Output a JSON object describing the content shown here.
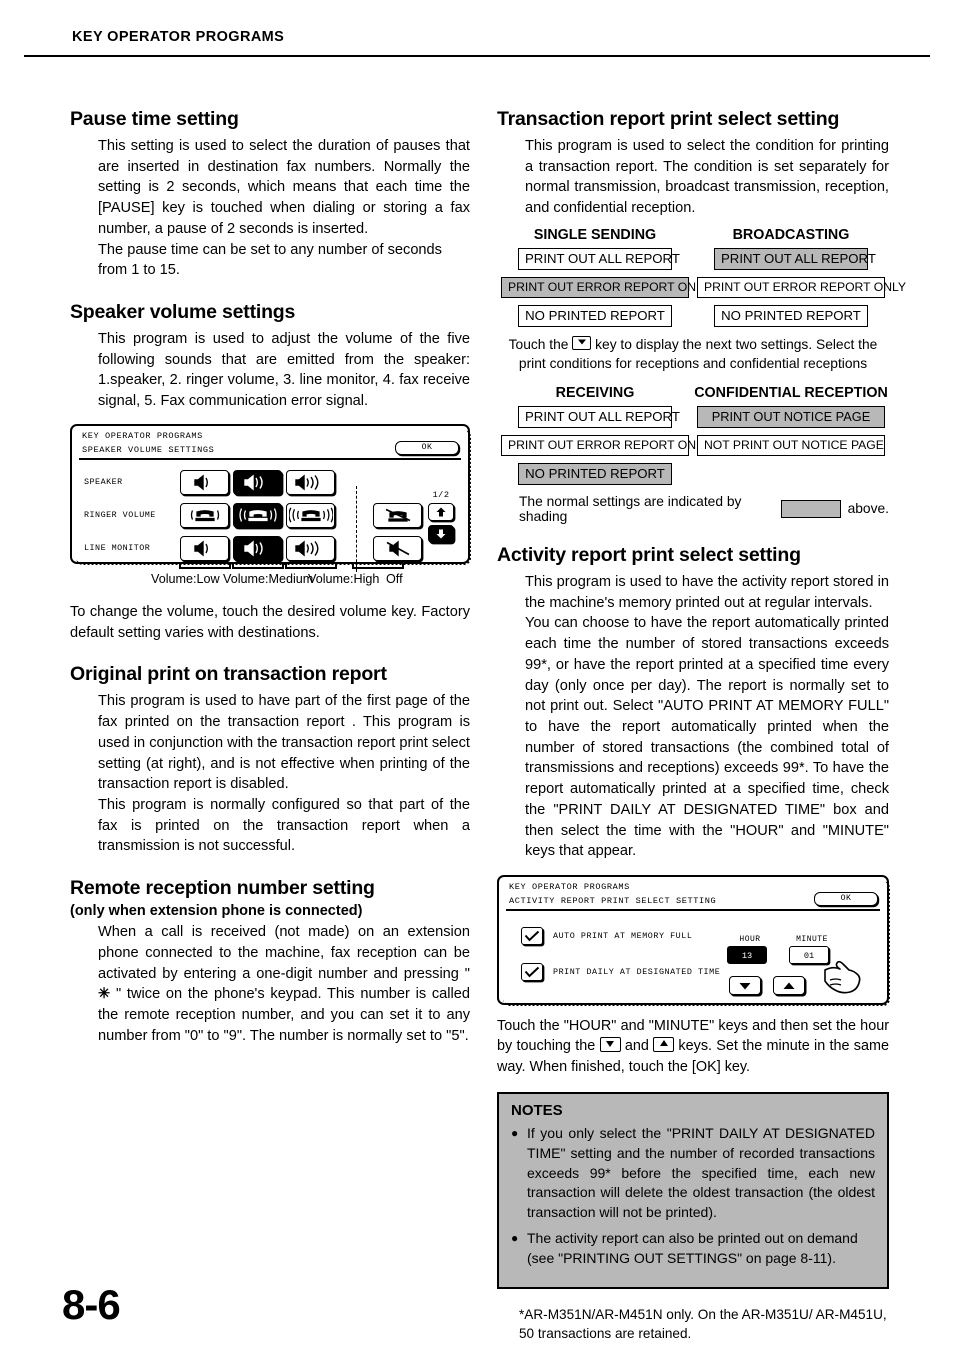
{
  "header": {
    "running_head": "KEY OPERATOR PROGRAMS"
  },
  "page_number": "8-6",
  "left_column": {
    "pause_time": {
      "heading": "Pause time setting",
      "p1": "This setting is used to select the duration of pauses that are inserted in destination fax numbers. Normally the setting is 2 seconds, which means that each time the [PAUSE] key is touched when dialing or storing a fax number, a pause of 2 seconds is inserted.",
      "p2": "The pause time can be set to any number of seconds from 1 to 15."
    },
    "speaker_volume": {
      "heading": "Speaker volume settings",
      "p1": "This program is used to adjust the volume of the five following sounds that are emitted from the speaker: 1.speaker, 2. ringer volume, 3. line monitor, 4. fax receive signal, 5. Fax communication error signal.",
      "panel": {
        "title_line1": "KEY OPERATOR PROGRAMS",
        "title_line2": "SPEAKER VOLUME SETTINGS",
        "ok_label": "OK",
        "page_indicator": "1/2",
        "rows": [
          {
            "label": "SPEAKER",
            "icon": "speaker-icon",
            "selected_index": 1,
            "has_off": false
          },
          {
            "label": "RINGER VOLUME",
            "icon": "phone-ring-icon",
            "selected_index": 1,
            "has_off": true
          },
          {
            "label": "LINE MONITOR",
            "icon": "speaker-icon",
            "selected_index": 1,
            "has_off": true
          }
        ],
        "nav": {
          "up": "up-arrow-icon",
          "down": "down-arrow-icon",
          "selected": "down"
        }
      },
      "captions": [
        "Volume:Low",
        "Volume:Medium",
        "Volume:High",
        "Off"
      ],
      "p2": "To change the volume, touch the desired volume key. Factory default setting varies with destinations."
    },
    "original_print": {
      "heading": "Original print on transaction report",
      "p1": "This program is used to have part of the first page of the fax printed on the transaction report . This program is used in conjunction with the transaction report print select setting (at right), and is not effective when printing of the transaction report is disabled.",
      "p2": "This program is normally configured so that part of the fax is printed on the transaction report when a transmission is not successful."
    },
    "remote_reception": {
      "heading": "Remote reception number setting",
      "subheading": "(only when extension phone is connected)",
      "p1_before": "When a call is received (not made) on an extension phone connected to the machine, fax reception can be activated by entering a one-digit number and pressing \" ",
      "p1_symbol": "✳",
      "p1_after": " \" twice on the phone's keypad. This number is called the remote reception number, and you can set it to any number from \"0\" to \"9\". The number is normally set to \"5\"."
    }
  },
  "right_column": {
    "transaction_report": {
      "heading": "Transaction report print select setting",
      "p1": "This program is used to select the condition for printing a transaction report. The condition is set separately for normal transmission, broadcast transmission, reception, and confidential reception.",
      "group1": {
        "col1_title": "SINGLE SENDING",
        "col2_title": "BROADCASTING",
        "col1_options": [
          {
            "label": "PRINT OUT ALL REPORT",
            "shaded": false,
            "size": "w-all"
          },
          {
            "label": "PRINT OUT ERROR REPORT ONLY",
            "shaded": true,
            "size": "w-err"
          },
          {
            "label": "NO PRINTED REPORT",
            "shaded": false,
            "size": "w-no"
          }
        ],
        "col2_options": [
          {
            "label": "PRINT OUT ALL REPORT",
            "shaded": true,
            "size": "w-all"
          },
          {
            "label": "PRINT OUT ERROR REPORT ONLY",
            "shaded": false,
            "size": "w-err"
          },
          {
            "label": "NO PRINTED REPORT",
            "shaded": false,
            "size": "w-no"
          }
        ]
      },
      "touch_note_before": "Touch the ",
      "touch_note_after": " key to display the next two settings. Select the print conditions for receptions and confidential receptions",
      "group2": {
        "col1_title": "RECEIVING",
        "col2_title": "CONFIDENTIAL RECEPTION",
        "col1_options": [
          {
            "label": "PRINT OUT ALL REPORT",
            "shaded": false,
            "size": "w-all"
          },
          {
            "label": "PRINT OUT ERROR REPORT ONLY",
            "shaded": false,
            "size": "w-err"
          },
          {
            "label": "NO PRINTED REPORT",
            "shaded": true,
            "size": "w-no"
          }
        ],
        "col2_options": [
          {
            "label": "PRINT OUT NOTICE PAGE",
            "shaded": true,
            "size": "w-notice"
          },
          {
            "label": "NOT PRINT OUT NOTICE PAGE",
            "shaded": false,
            "size": "w-not"
          }
        ]
      },
      "shade_note_before": "The normal settings are indicated by shading",
      "shade_note_after": "above."
    },
    "activity_report": {
      "heading": "Activity report print select setting",
      "p1": "This program is used to have the activity report stored in the machine's memory printed out at regular intervals.",
      "p2": "You can choose to have the report automatically printed each time the number of stored transactions exceeds 99*, or have the report printed at a specified time every day (only once per day). The report is normally set to not print out. Select \"AUTO PRINT AT MEMORY FULL\" to have the report automatically printed when the number of stored transactions (the combined total of transmissions and receptions) exceeds 99*. To have the report automatically printed at a specified time, check the \"PRINT DAILY AT DESIGNATED TIME\" box and then select the time with the \"HOUR\" and \"MINUTE\" keys that appear.",
      "panel": {
        "title_line1": "KEY OPERATOR PROGRAMS",
        "title_line2": "ACTIVITY REPORT PRINT SELECT SETTING",
        "ok_label": "OK",
        "checkbox1_label": "AUTO PRINT AT MEMORY FULL",
        "checkbox1_checked": true,
        "checkbox2_label": "PRINT DAILY AT DESIGNATED TIME",
        "checkbox2_checked": true,
        "hour_label": "HOUR",
        "minute_label": "MINUTE",
        "hour_value": "13",
        "minute_value": "01",
        "hour_selected": true,
        "down_key": "down-arrow-icon",
        "up_key": "up-arrow-icon"
      },
      "post_note_1": "Touch the \"HOUR\" and \"MINUTE\" keys and then set the hour by touching the ",
      "post_note_2": " and ",
      "post_note_3": " keys. Set the minute in the same way. When finished, touch the [OK] key."
    },
    "notes": {
      "title": "NOTES",
      "bullet": "●",
      "items": [
        "If you only select the \"PRINT DAILY AT DESIGNATED TIME\" setting and the number of recorded transactions exceeds 99* before the specified time, each new transaction will delete the oldest transaction (the oldest transaction will not be printed).",
        "The activity report can also be printed out on demand (see \"PRINTING OUT SETTINGS\" on page 8-11)."
      ]
    },
    "footnote": "*AR-M351N/AR-M451N only. On the AR-M351U/ AR-M451U, 50 transactions are retained."
  },
  "colors": {
    "shading": "#b8b8b8",
    "ink": "#000000",
    "paper": "#ffffff"
  }
}
